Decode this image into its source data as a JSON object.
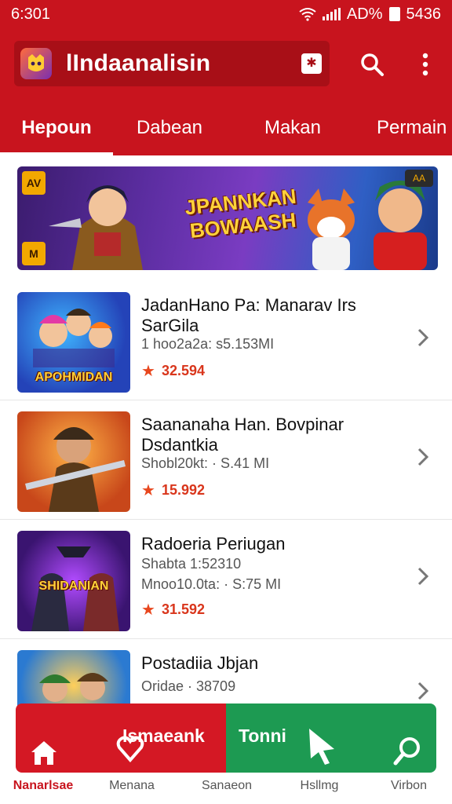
{
  "status_bar": {
    "time": "6:301",
    "battery_text": "AD%",
    "right_text": "5436"
  },
  "app_bar": {
    "title": "lIndaanalisin",
    "logo_icon": "app-logo-icon",
    "search_icon": "search-icon",
    "menu_icon": "more-vert-icon"
  },
  "tabs": [
    {
      "label": "Hepoun",
      "active": true
    },
    {
      "label": "Dabean",
      "active": false
    },
    {
      "label": "Makan",
      "active": false
    },
    {
      "label": "Permain",
      "active": false
    }
  ],
  "banner": {
    "headline_line1": "JPANNKAN",
    "headline_line2": "BOWAASH",
    "badge_left": "AV",
    "badge_left_bottom": "M",
    "badge_right": "AA"
  },
  "games": [
    {
      "title": "JadanHano Pa: Manarav  Irs SarGila",
      "meta1": "1 hoo2a2a: s5.153MI",
      "meta2": "",
      "rating": "32.594",
      "thumb_label": "APOHMIDAN"
    },
    {
      "title": "Saananaha Han. Bovpinar Dsdantkia",
      "meta1": "Shobl20kt: · S.41 MI",
      "meta2": "",
      "rating": "15.992",
      "thumb_label": ""
    },
    {
      "title": "Radoeria Periugan",
      "meta1": "Shabta 1:52310",
      "meta2": "Mnoo10.0ta: · S:75 MI",
      "rating": "31.592",
      "thumb_label": "SHIDANIAN"
    },
    {
      "title": "Postadiia Jbjan",
      "meta1": "Oridae · 38709",
      "meta2": "",
      "rating": "",
      "thumb_label": ""
    }
  ],
  "bottom_cta": {
    "left_label": "Ismaeank",
    "right_label": "Tonni"
  },
  "bottom_nav": [
    {
      "label": "Nanarlsae",
      "icon": "home-icon",
      "active": true
    },
    {
      "label": "Menana",
      "icon": "heart-icon",
      "active": false
    },
    {
      "label": "Sanaeon",
      "icon": "",
      "active": false
    },
    {
      "label": "Hsllmg",
      "icon": "cursor-icon",
      "active": false
    },
    {
      "label": "Virbon",
      "icon": "search-icon",
      "active": false
    }
  ],
  "colors": {
    "brand_red": "#c8141e",
    "accent_green": "#1d9a52",
    "rating_orange": "#d9361c"
  }
}
